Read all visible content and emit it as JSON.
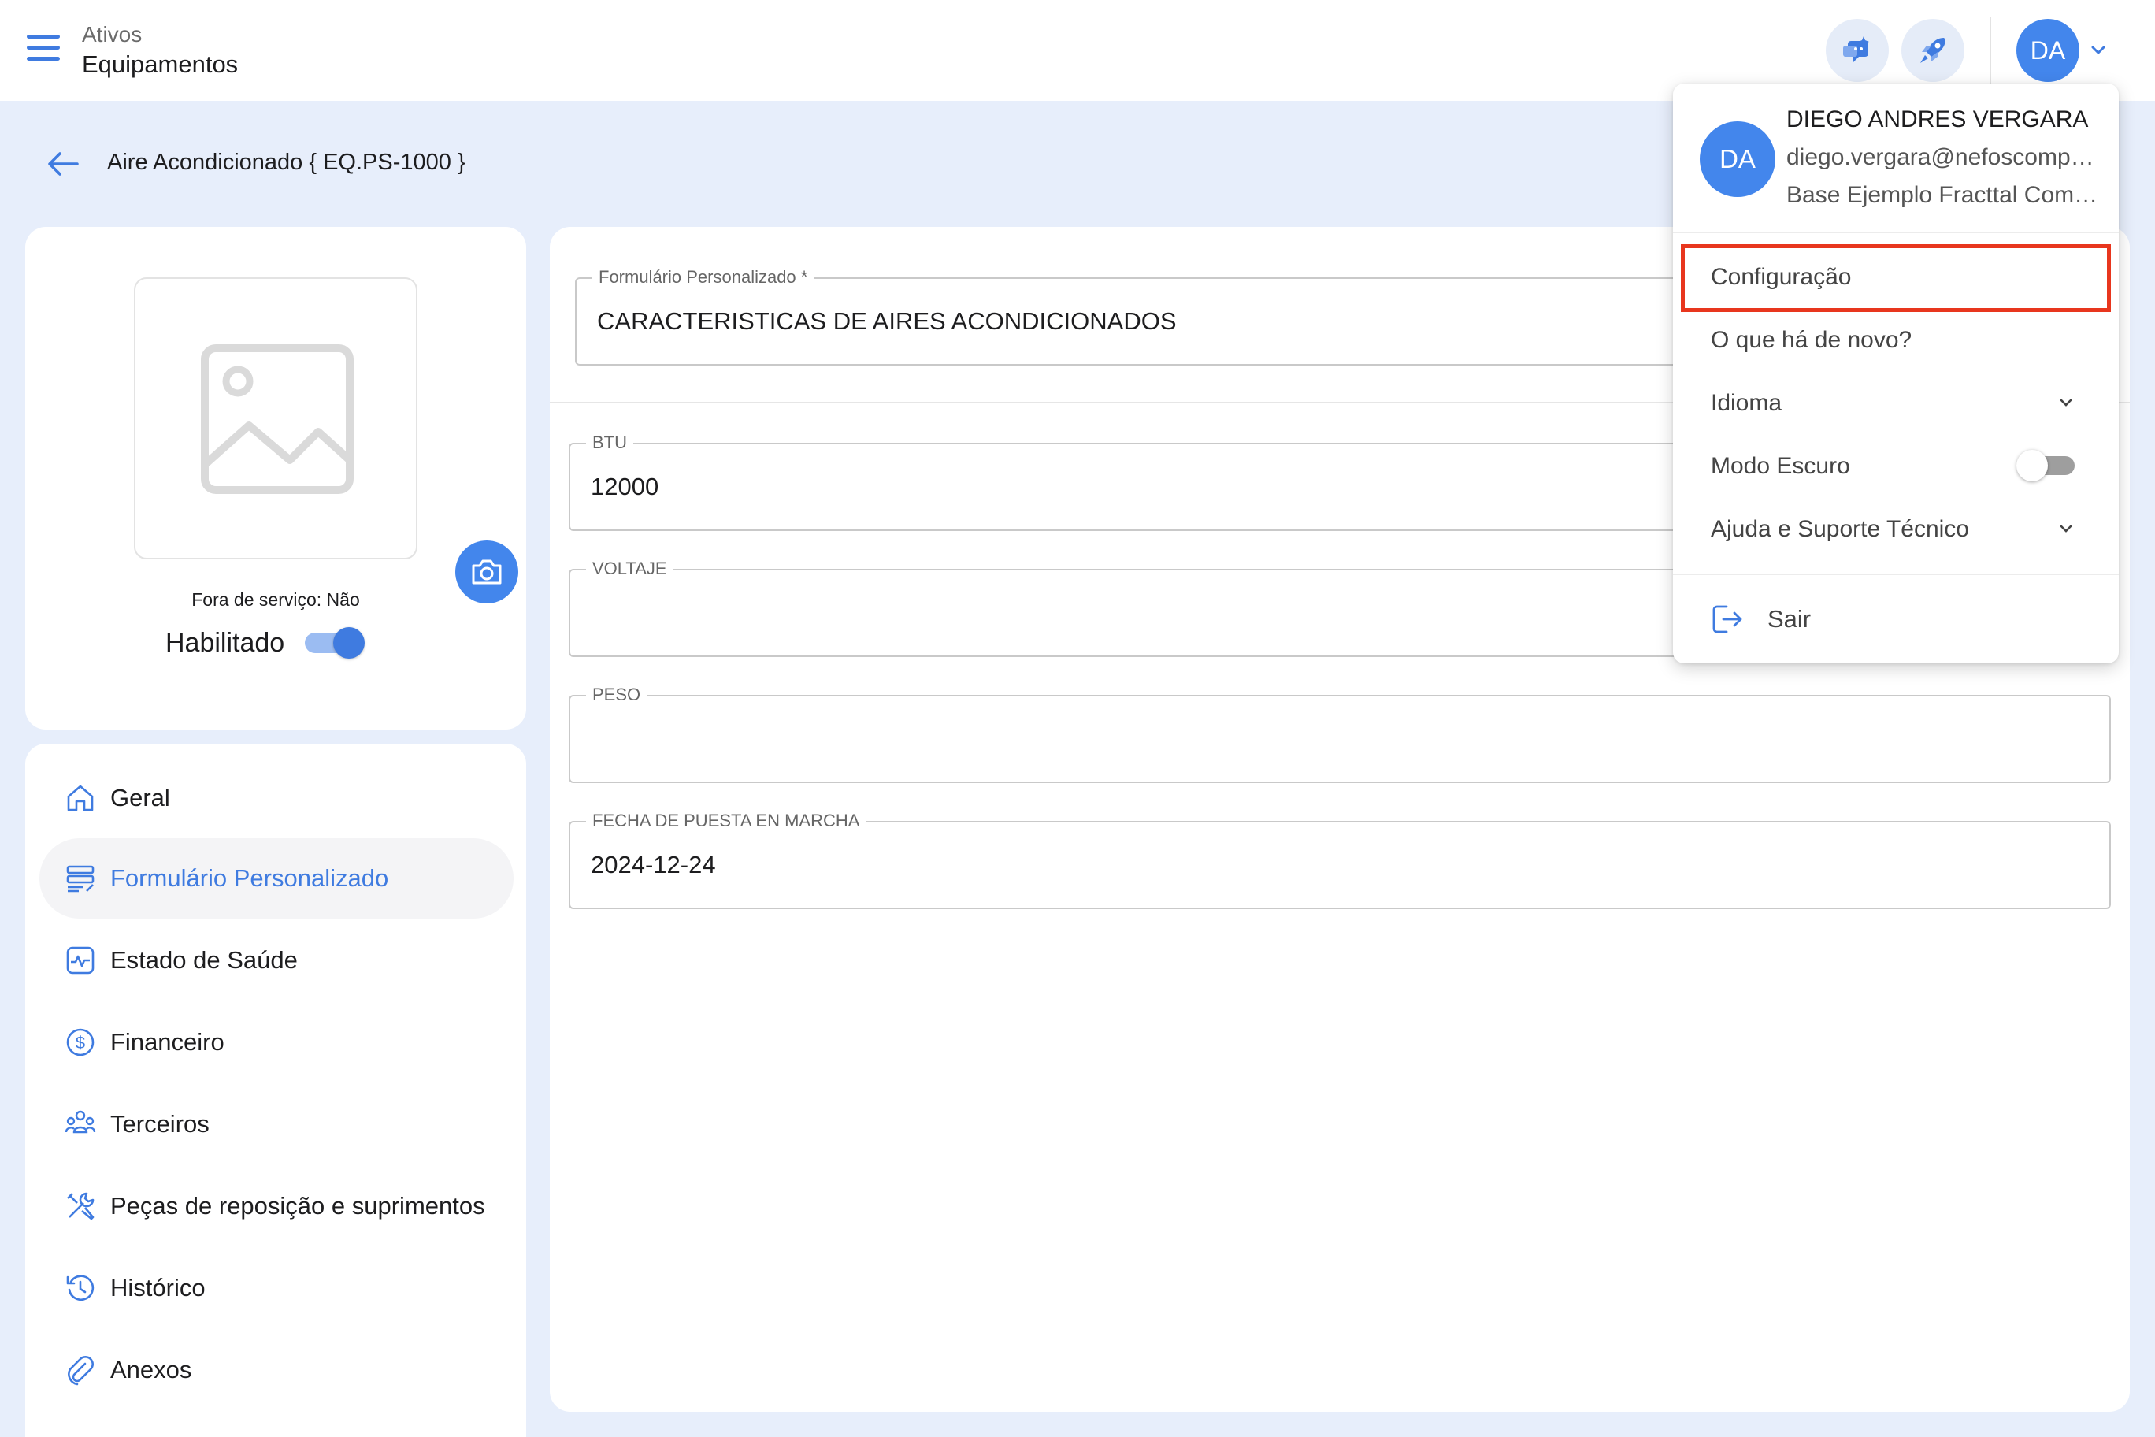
{
  "header": {
    "breadcrumb_parent": "Ativos",
    "page_title": "Equipamentos",
    "avatar_initials": "DA"
  },
  "asset": {
    "title": "Aire Acondicionado { EQ.PS-1000 }",
    "out_of_service": "Fora de serviço: Não",
    "enabled_label": "Habilitado",
    "enabled": true
  },
  "nav": {
    "items": [
      {
        "label": "Geral",
        "icon": "home-icon"
      },
      {
        "label": "Formulário Personalizado",
        "icon": "form-icon",
        "active": true
      },
      {
        "label": "Estado de Saúde",
        "icon": "health-icon"
      },
      {
        "label": "Financeiro",
        "icon": "dollar-icon"
      },
      {
        "label": "Terceiros",
        "icon": "people-icon"
      },
      {
        "label": "Peças de reposição e suprimentos",
        "icon": "tools-icon"
      },
      {
        "label": "Histórico",
        "icon": "history-icon"
      },
      {
        "label": "Anexos",
        "icon": "attachment-icon"
      }
    ]
  },
  "form": {
    "custom_form_label": "Formulário Personalizado *",
    "custom_form_value": "CARACTERISTICAS DE AIRES ACONDICIONADOS",
    "fields": [
      {
        "label": "BTU",
        "value": "12000"
      },
      {
        "label": "VOLTAJE",
        "value": ""
      },
      {
        "label": "PESO",
        "value": ""
      },
      {
        "label": "FECHA DE PUESTA EN MARCHA",
        "value": "2024-12-24"
      }
    ]
  },
  "user_menu": {
    "initials": "DA",
    "name": "DIEGO ANDRES VERGARA",
    "email": "diego.vergara@nefoscompany.com",
    "company": "Base Ejemplo Fracttal Company",
    "items": {
      "settings": "Configuração",
      "whats_new": "O que há de novo?",
      "language": "Idioma",
      "dark_mode": "Modo Escuro",
      "help": "Ajuda e Suporte Técnico"
    },
    "dark_mode_on": false,
    "logout": "Sair"
  },
  "colors": {
    "accent": "#3f7be0",
    "background": "#e7eefb",
    "highlight": "#e8361e"
  }
}
